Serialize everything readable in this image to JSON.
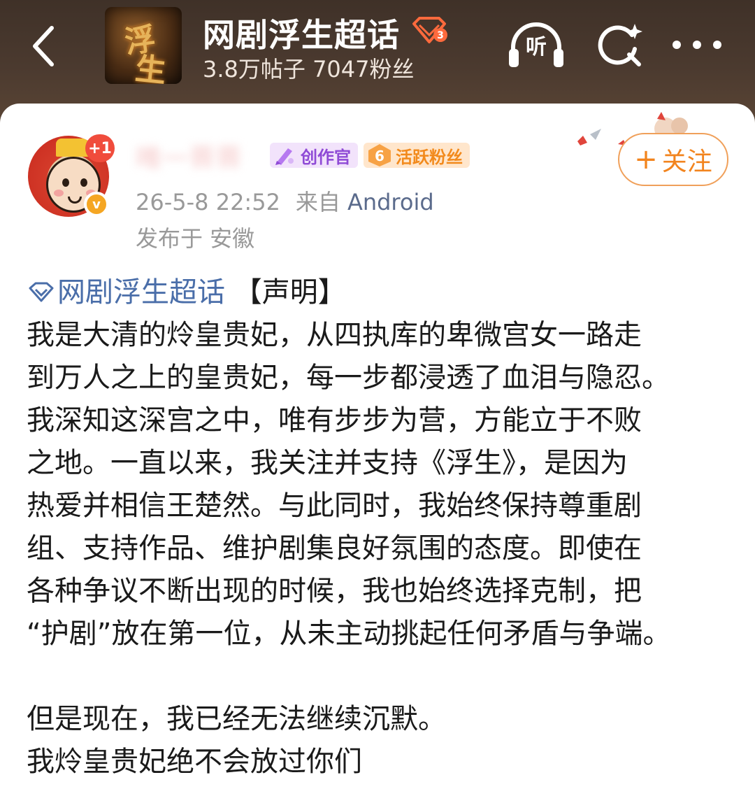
{
  "header": {
    "topic_title": "网剧浮生超话",
    "topic_stats": "3.8万帖子 7047粉丝",
    "level_badge": "3",
    "cover_chars": [
      "浮",
      "生"
    ],
    "listen_label": "听",
    "colors": {
      "header_bg": "#4b3a2f",
      "title": "#ffffff",
      "level_badge": "#ff6a3d"
    }
  },
  "post": {
    "author": {
      "username": "唯一晋晋",
      "plus_badge": "+1",
      "verified_mark": "v",
      "tag_creator": "创作官",
      "tag_fan_level": "6",
      "tag_fan": "活跃粉丝"
    },
    "time": "26-5-8 22:52",
    "source_label": "来自",
    "source": "Android",
    "location": "发布于 安徽",
    "follow_label": "关注",
    "follow_plus": "+",
    "topic_link": "网剧浮生超话",
    "title_tag": "【声明】",
    "lines": [
      "我是大清的炩皇贵妃，从四执库的卑微宫女一路走",
      "到万人之上的皇贵妃，每一步都浸透了血泪与隐忍。",
      "我深知这深宫之中，唯有步步为营，方能立于不败",
      "之地。一直以来，我关注并支持《浮生》，是因为",
      "热爱并相信王楚然。与此同时，我始终保持尊重剧",
      "组、支持作品、维护剧集良好氛围的态度。即使在",
      "各种争议不断出现的时候，我也始终选择克制，把",
      "“护剧”放在第一位，从未主动挑起任何矛盾与争端。"
    ],
    "closing_lines": [
      "但是现在，我已经无法继续沉默。",
      "我炩皇贵妃绝不会放过你们"
    ],
    "colors": {
      "link": "#4a6ea9",
      "follow": "#f2841e",
      "meta": "#999999"
    }
  }
}
